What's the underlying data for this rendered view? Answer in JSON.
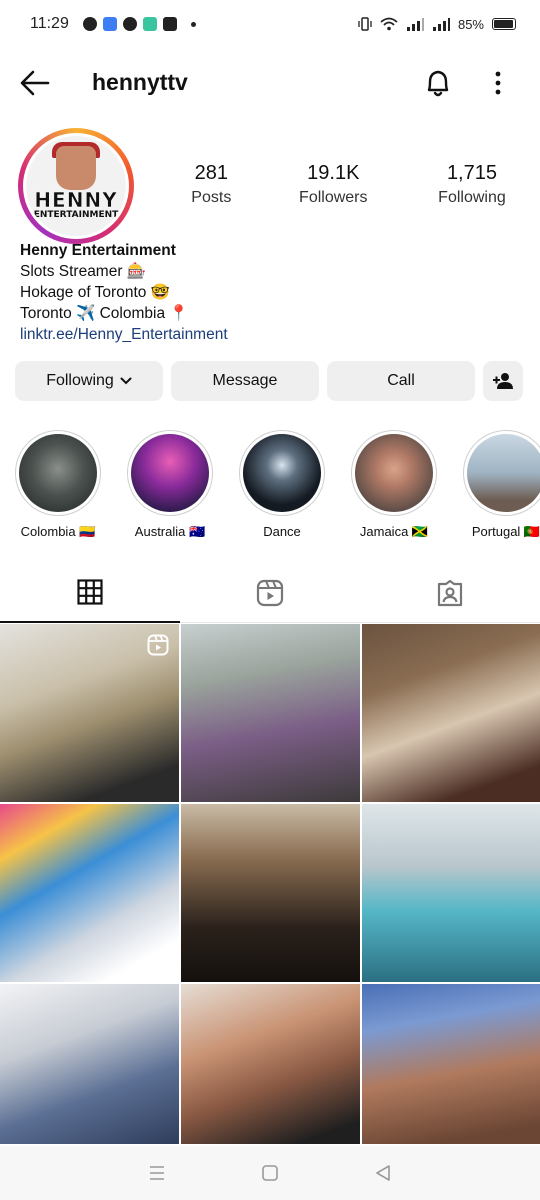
{
  "status_bar": {
    "time": "11:29",
    "battery": "85%",
    "icons": [
      "messenger-icon",
      "app-icon",
      "facebook-icon",
      "app-icon",
      "youtube-icon"
    ]
  },
  "header": {
    "username": "hennyttv",
    "icons": [
      "back-arrow-icon",
      "bell-icon",
      "more-icon"
    ]
  },
  "avatar": {
    "text_main": "HENNY",
    "text_sub": "ENTERTAINMENT"
  },
  "stats": [
    {
      "value": "281",
      "label": "Posts"
    },
    {
      "value": "19.1K",
      "label": "Followers"
    },
    {
      "value": "1,715",
      "label": "Following"
    }
  ],
  "bio": {
    "name": "Henny Entertainment",
    "line1": "Slots Streamer 🎰",
    "line2": "Hokage of Toronto 🤓",
    "line3": "Toronto ✈️ Colombia 📍",
    "link": "linktr.ee/Henny_Entertainment"
  },
  "buttons": {
    "following": "Following",
    "message": "Message",
    "call": "Call"
  },
  "highlights": [
    {
      "label": "Colombia 🇨🇴"
    },
    {
      "label": "Australia 🇦🇺"
    },
    {
      "label": "Dance"
    },
    {
      "label": "Jamaica 🇯🇲"
    },
    {
      "label": "Portugal 🇵🇹"
    }
  ],
  "tabs": [
    "grid-icon",
    "reels-icon",
    "tagged-icon"
  ],
  "colors": {
    "link": "#1e3e7a",
    "button_bg": "#efefef",
    "ring_gradient": [
      "#f7b233",
      "#d62e72",
      "#a530c0"
    ]
  }
}
